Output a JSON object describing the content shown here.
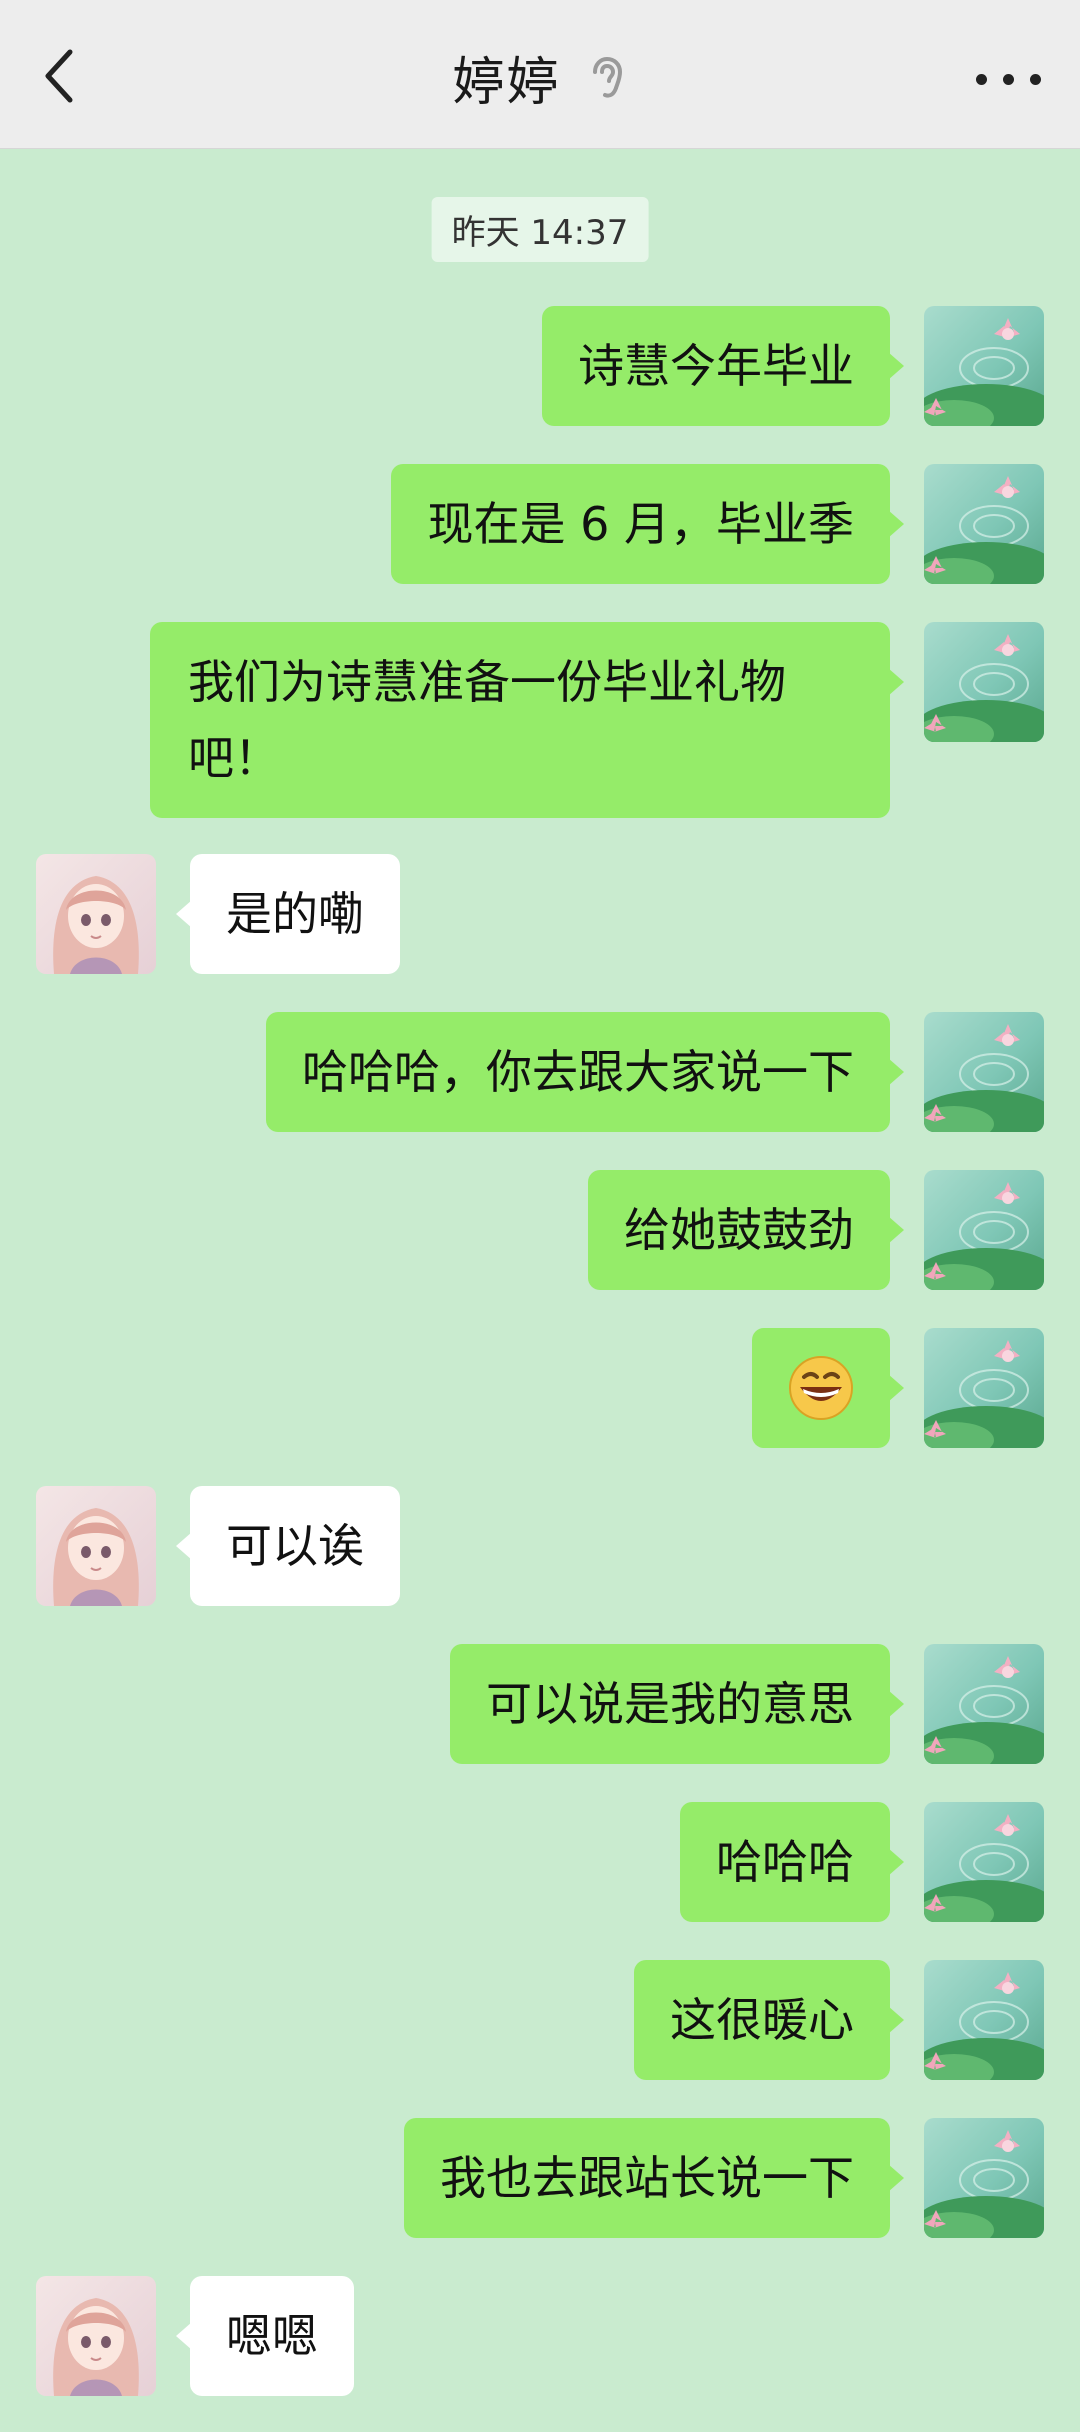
{
  "header": {
    "contact_name": "婷婷",
    "back_icon": "chevron-left-icon",
    "ear_icon": "ear-icon",
    "more_icon": "more-dots-icon"
  },
  "timestamp": "昨天 14:37",
  "messages": [
    {
      "from": "me",
      "text": "诗慧今年毕业"
    },
    {
      "from": "me",
      "text": "现在是 6 月，毕业季"
    },
    {
      "from": "me",
      "text": "我们为诗慧准备一份毕业礼物吧！"
    },
    {
      "from": "them",
      "text": "是的嘞"
    },
    {
      "from": "me",
      "text": "哈哈哈，你去跟大家说一下"
    },
    {
      "from": "me",
      "text": "给她鼓鼓劲"
    },
    {
      "from": "me",
      "emoji": "grinning-face-icon"
    },
    {
      "from": "them",
      "text": "可以诶"
    },
    {
      "from": "me",
      "text": "可以说是我的意思"
    },
    {
      "from": "me",
      "text": "哈哈哈"
    },
    {
      "from": "me",
      "text": "这很暖心"
    },
    {
      "from": "me",
      "text": "我也去跟站长说一下"
    },
    {
      "from": "them",
      "text": "嗯嗯"
    }
  ],
  "colors": {
    "background": "#c9ebcf",
    "my_bubble": "#95ec69",
    "their_bubble": "#ffffff",
    "header": "#ededed"
  }
}
